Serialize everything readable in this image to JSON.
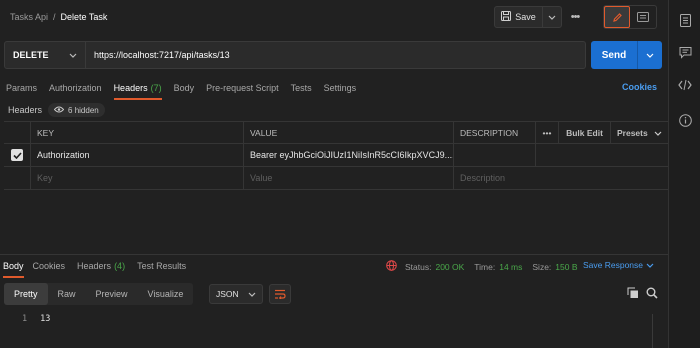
{
  "breadcrumb": {
    "parent": "Tasks Api",
    "separator": "/",
    "current": "Delete Task"
  },
  "toolbar": {
    "save_label": "Save",
    "more_label": "•••"
  },
  "request": {
    "method": "DELETE",
    "url": "https://localhost:7217/api/tasks/13",
    "send_label": "Send"
  },
  "request_tabs": [
    {
      "label": "Params"
    },
    {
      "label": "Authorization"
    },
    {
      "label": "Headers",
      "count": "(7)"
    },
    {
      "label": "Body"
    },
    {
      "label": "Pre-request Script"
    },
    {
      "label": "Tests"
    },
    {
      "label": "Settings"
    }
  ],
  "cookies_link": "Cookies",
  "headers_sub": {
    "label": "Headers",
    "hidden": "6 hidden"
  },
  "table": {
    "columns": {
      "key": "KEY",
      "value": "VALUE",
      "description": "DESCRIPTION",
      "more": "•••",
      "bulk": "Bulk Edit",
      "presets": "Presets"
    },
    "rows": [
      {
        "key": "Authorization",
        "value": "Bearer eyJhbGciOiJIUzI1NiIsInR5cCI6IkpXVCJ9....",
        "description": ""
      }
    ],
    "placeholders": {
      "key": "Key",
      "value": "Value",
      "description": "Description"
    }
  },
  "response": {
    "tabs": [
      {
        "label": "Body"
      },
      {
        "label": "Cookies"
      },
      {
        "label": "Headers",
        "count": "(4)"
      },
      {
        "label": "Test Results"
      }
    ],
    "status_label": "Status:",
    "status_value": "200 OK",
    "time_label": "Time:",
    "time_value": "14 ms",
    "size_label": "Size:",
    "size_value": "150 B",
    "save_response": "Save Response",
    "views": [
      "Pretty",
      "Raw",
      "Preview",
      "Visualize"
    ],
    "format": "JSON",
    "code": {
      "line_number": "1",
      "text": "13"
    }
  },
  "colors": {
    "accent": "#e05a2c",
    "primary": "#1b6fd1",
    "link": "#4a9df0",
    "success": "#4aa84a"
  }
}
